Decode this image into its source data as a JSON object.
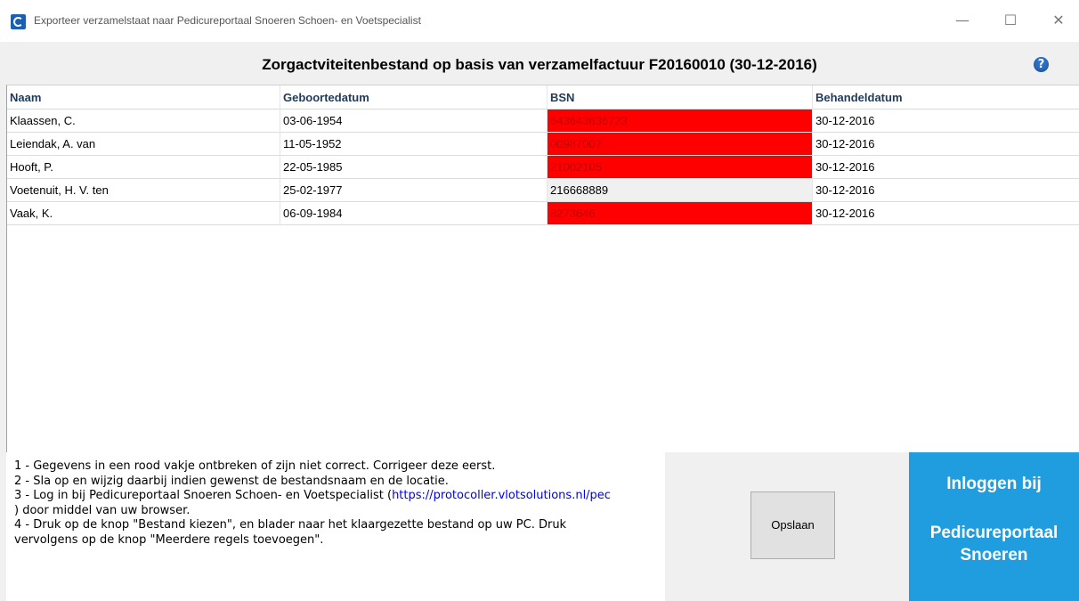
{
  "window": {
    "title": "Exporteer verzamelstaat naar Pedicureportaal Snoeren Schoen- en Voetspecialist",
    "minimize_icon": "minimize-icon",
    "maximize_icon": "maximize-icon",
    "close_icon": "close-icon"
  },
  "heading": "Zorgactviteitenbestand op basis van verzamelfactuur F20160010 (30-12-2016)",
  "help_icon": "?",
  "colors": {
    "error_red": "#ff0000",
    "portal_blue": "#1f9ddf",
    "header_text": "#1e3b5a"
  },
  "table": {
    "columns": [
      "Naam",
      "Geboortedatum",
      "BSN",
      "Behandeldatum"
    ],
    "rows": [
      {
        "naam": "Klaassen, C.",
        "geboortedatum": "03-06-1954",
        "bsn": "643643636723",
        "behandeldatum": "30-12-2016",
        "bsn_error": true
      },
      {
        "naam": "Leiendak, A. van",
        "geboortedatum": "11-05-1952",
        "bsn": "00987007",
        "behandeldatum": "30-12-2016",
        "bsn_error": true
      },
      {
        "naam": "Hooft, P.",
        "geboortedatum": "22-05-1985",
        "bsn": "21002105",
        "behandeldatum": "30-12-2016",
        "bsn_error": true
      },
      {
        "naam": "Voetenuit, H. V.  ten",
        "geboortedatum": "25-02-1977",
        "bsn": "216668889",
        "behandeldatum": "30-12-2016",
        "bsn_error": false
      },
      {
        "naam": "Vaak, K.",
        "geboortedatum": "06-09-1984",
        "bsn": "8273646",
        "behandeldatum": "30-12-2016",
        "bsn_error": true
      }
    ]
  },
  "instructions": {
    "line1": "1 - Gegevens in een rood vakje ontbreken of zijn niet correct. Corrigeer deze eerst.",
    "line2": "2 - Sla op en wijzig daarbij indien gewenst de bestandsnaam en de locatie.",
    "line3_prefix": "3 - Log in bij Pedicureportaal Snoeren Schoen- en Voetspecialist (",
    "line3_link": "https://protocoller.vlotsolutions.nl/pec",
    "line4": ") door middel van uw browser.",
    "line5": "4 - Druk op de knop \"Bestand kiezen\", en blader naar het klaargezette bestand op uw PC. Druk",
    "line6": "vervolgens op de knop \"Meerdere regels toevoegen\"."
  },
  "buttons": {
    "save": "Opslaan",
    "portal_line1": "Inloggen bij",
    "portal_line2": "Pedicureportaal",
    "portal_line3": "Snoeren"
  }
}
